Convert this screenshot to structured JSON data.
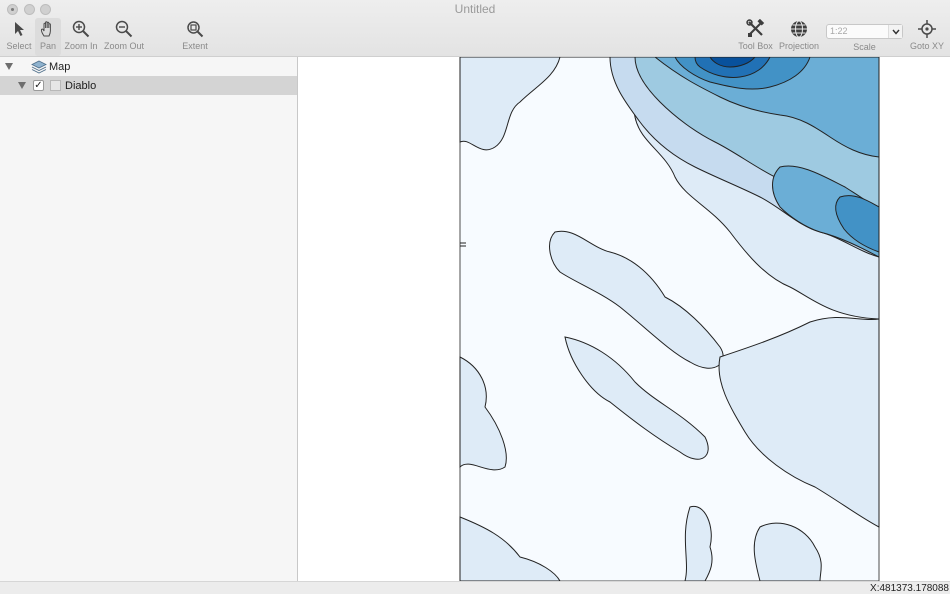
{
  "window": {
    "title": "Untitled"
  },
  "toolbar": {
    "left_tools": [
      {
        "label": "Select",
        "icon": "arrow-pointer-icon"
      },
      {
        "label": "Pan",
        "icon": "hand-icon"
      },
      {
        "label": "Zoom In",
        "icon": "zoom-in-icon"
      },
      {
        "label": "Zoom Out",
        "icon": "zoom-out-icon"
      },
      {
        "label": "Extent",
        "icon": "extent-icon"
      }
    ],
    "active_tool": "Pan",
    "right_tools": [
      {
        "label": "Tool Box",
        "icon": "tools-icon"
      },
      {
        "label": "Projection",
        "icon": "globe-icon"
      },
      {
        "label": "Goto XY",
        "icon": "crosshair-icon"
      }
    ],
    "scale": {
      "label": "Scale",
      "placeholder": "1:22"
    }
  },
  "layers": {
    "root": {
      "label": "Map"
    },
    "items": [
      {
        "label": "Diablo",
        "checked": true,
        "check_glyph": "✓"
      }
    ]
  },
  "map": {
    "colors": [
      "#f7fbff",
      "#deebf7",
      "#c6dbef",
      "#9ecae1",
      "#6baed6",
      "#4292c6",
      "#2171b5",
      "#08519c"
    ]
  },
  "status": {
    "coordinate": "X:481373.178088"
  }
}
